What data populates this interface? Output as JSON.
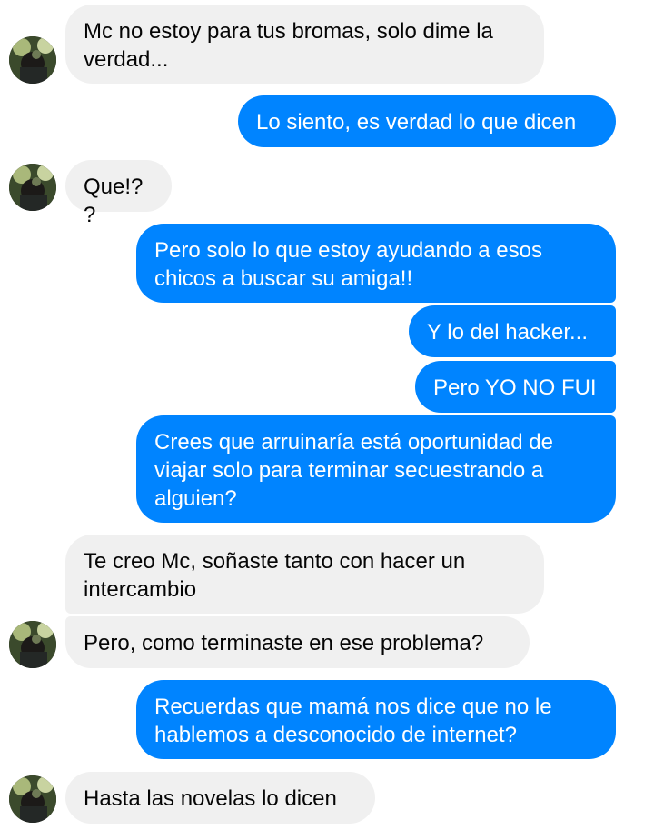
{
  "conversation": {
    "messages": [
      {
        "from": "other",
        "text": "Mc no estoy para tus bromas, solo dime la verdad..."
      },
      {
        "from": "me",
        "text": "Lo siento, es verdad lo que dicen"
      },
      {
        "from": "other",
        "text": "Que!??"
      },
      {
        "from": "me",
        "text": "Pero solo lo que estoy ayudando a esos chicos a buscar su amiga!!"
      },
      {
        "from": "me",
        "text": "Y lo del hacker..."
      },
      {
        "from": "me",
        "text": "Pero YO NO FUI"
      },
      {
        "from": "me",
        "text": "Crees que arruinaría está oportunidad de viajar solo para terminar secuestrando a alguien?"
      },
      {
        "from": "other",
        "text": "Te creo Mc, soñaste tanto con hacer un intercambio"
      },
      {
        "from": "other",
        "text": "Pero, como terminaste en ese problema?"
      },
      {
        "from": "me",
        "text": "Recuerdas que mamá nos dice que no le hablemos a desconocido de internet?"
      },
      {
        "from": "other",
        "text": "Hasta las novelas lo dicen"
      }
    ]
  },
  "colors": {
    "outgoing_bubble": "#0084ff",
    "incoming_bubble": "#f0f0f0",
    "outgoing_text": "#ffffff",
    "incoming_text": "#050505"
  },
  "icons": {
    "contact_avatar": "contact-avatar-photo"
  }
}
